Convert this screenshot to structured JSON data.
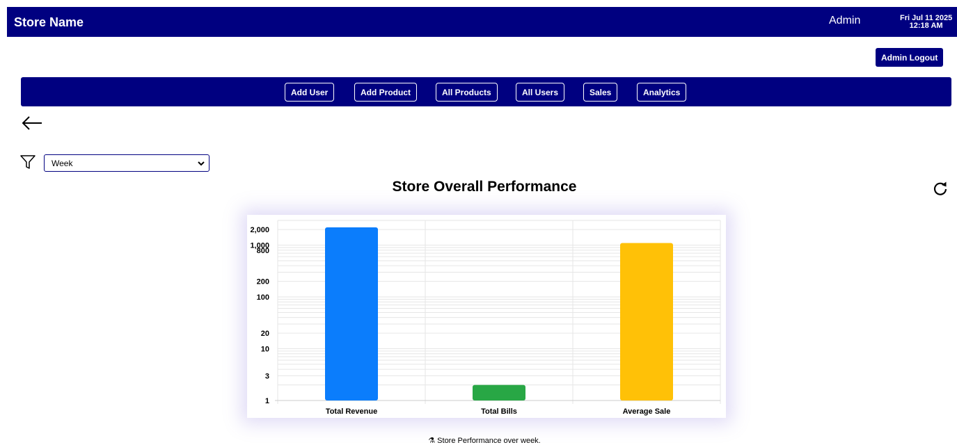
{
  "header": {
    "store_name": "Store Name",
    "user_role": "Admin",
    "date": "Fri Jul 11 2025",
    "time": "12:18 AM"
  },
  "logout_label": "Admin Logout",
  "nav": {
    "items": [
      {
        "label": "Add User"
      },
      {
        "label": "Add Product"
      },
      {
        "label": "All Products"
      },
      {
        "label": "All Users"
      },
      {
        "label": "Sales"
      },
      {
        "label": "Analytics"
      }
    ]
  },
  "filter": {
    "selected": "Week"
  },
  "chart_title": "Store Overall Performance",
  "chart_data": {
    "type": "bar",
    "title": "Store Overall Performance",
    "categories": [
      "Total Revenue",
      "Total Bills",
      "Average Sale"
    ],
    "values": [
      2200,
      2,
      1100
    ],
    "colors": [
      "#0b7dfc",
      "#28a745",
      "#ffc107"
    ],
    "y_scale": "log",
    "ylim": [
      1,
      3000
    ],
    "y_ticks": [
      1,
      3,
      10,
      20,
      100,
      200,
      800,
      1000,
      2000
    ],
    "y_tick_labels": [
      "1",
      "3",
      "10",
      "20",
      "100",
      "200",
      "800",
      "1,000",
      "2,000"
    ],
    "grid": true,
    "legend": "none"
  },
  "caption": {
    "icon": "⚗",
    "text": "Store Performance over week."
  },
  "colors": {
    "primary": "#000080"
  }
}
